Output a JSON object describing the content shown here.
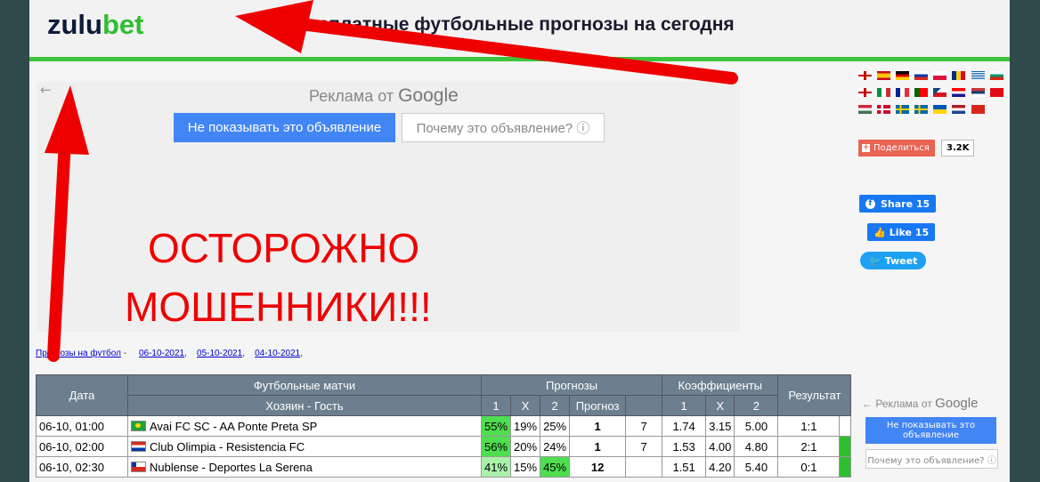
{
  "header": {
    "logo_a": "zulu",
    "logo_b": "bet",
    "title": "Бесплатные футбольные прогнозы на сегодня"
  },
  "ad_main": {
    "back": "←",
    "label_prefix": "Реклама от ",
    "label_brand": "Google",
    "hide_button": "Не показывать это объявление",
    "why_button": "Почему это объявление? ⓘ",
    "warning_line1": "ОСТОРОЖНО",
    "warning_line2": "МОШЕННИКИ!!!"
  },
  "nav": {
    "link_main": "Прогнозы на футбол",
    "sep": " - ",
    "dates": [
      "06-10-2021",
      "05-10-2021",
      "04-10-2021"
    ]
  },
  "table": {
    "headers": {
      "date": "Дата",
      "matches": "Футбольные матчи",
      "home_away": "Хозяин - Гость",
      "predictions": "Прогнозы",
      "odds": "Коэффициенты",
      "result": "Результат",
      "col1": "1",
      "colx": "X",
      "col2": "2",
      "forecast": "Прогноз"
    },
    "rows": [
      {
        "date": "06-10, 01:00",
        "match": "Avai FC SC - AA Ponte Preta SP",
        "p1": "55%",
        "px": "19%",
        "p2": "25%",
        "tip": "1",
        "extra": "7",
        "o1": "1.74",
        "ox": "3.15",
        "o2": "5.00",
        "result": "1:1"
      },
      {
        "date": "06-10, 02:00",
        "match": "Club Olimpia - Resistencia FC",
        "p1": "56%",
        "px": "20%",
        "p2": "24%",
        "tip": "1",
        "extra": "7",
        "o1": "1.53",
        "ox": "4.00",
        "o2": "4.80",
        "result": "2:1"
      },
      {
        "date": "06-10, 02:30",
        "match": "Nublense - Deportes La Serena",
        "p1": "41%",
        "px": "15%",
        "p2": "45%",
        "tip": "12",
        "extra": "",
        "o1": "1.51",
        "ox": "4.20",
        "o2": "5.40",
        "result": "0:1"
      }
    ]
  },
  "sidebar": {
    "share_label": "Поделиться",
    "share_count": "3.2K",
    "fb_share": "Share 15",
    "fb_like": "Like 15",
    "tweet": "Tweet",
    "ad_label_prefix": "Реклама от ",
    "ad_label_brand": "Google",
    "ad_hide": "Не показывать это объявление",
    "ad_why": "Почему это объявление? ⓘ"
  },
  "colors": {
    "accent_green": "#3cc43c",
    "warning_red": "#ee0000",
    "arrow_red": "#ee0000",
    "header_gray": "#6d7f8e"
  }
}
